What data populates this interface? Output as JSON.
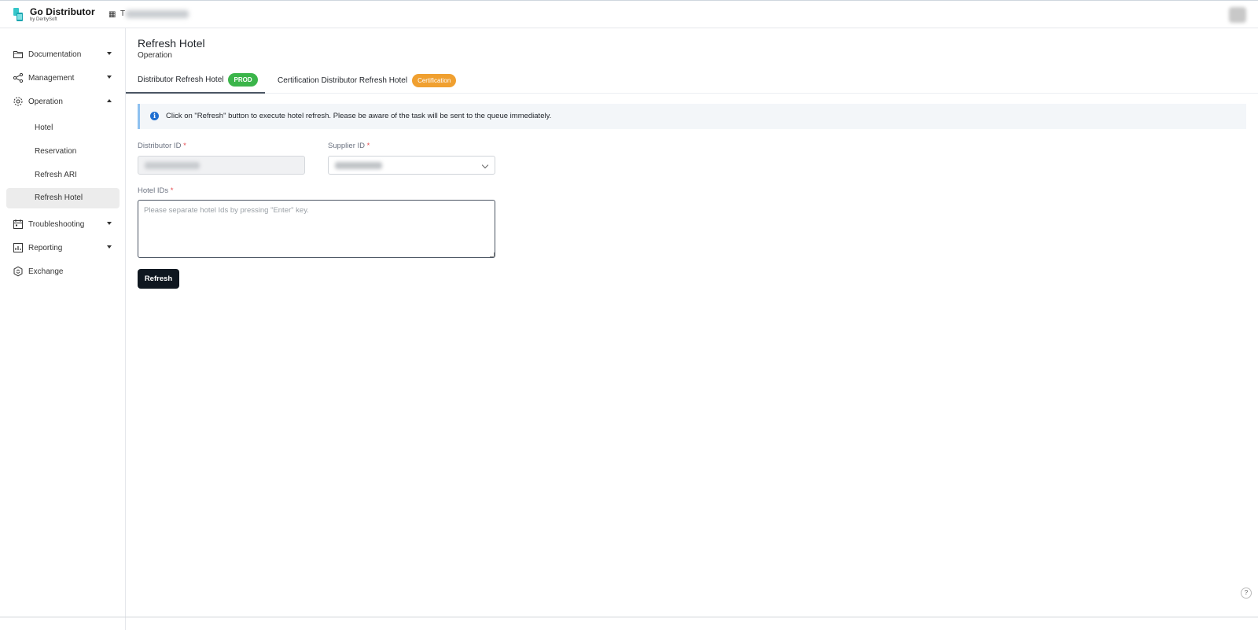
{
  "header": {
    "brand_title": "Go Distributor",
    "brand_subtitle": "by DerbySoft",
    "account_initial": "T"
  },
  "sidebar": {
    "items": [
      {
        "label": "Documentation",
        "icon": "folder-icon",
        "expanded": false
      },
      {
        "label": "Management",
        "icon": "share-icon",
        "expanded": false
      },
      {
        "label": "Operation",
        "icon": "gear-icon",
        "expanded": true
      },
      {
        "label": "Troubleshooting",
        "icon": "calendar-icon",
        "expanded": false
      },
      {
        "label": "Reporting",
        "icon": "report-icon",
        "expanded": false
      },
      {
        "label": "Exchange",
        "icon": "hexagon-icon"
      }
    ],
    "operation_children": [
      {
        "label": "Hotel",
        "active": false
      },
      {
        "label": "Reservation",
        "active": false
      },
      {
        "label": "Refresh ARI",
        "active": false
      },
      {
        "label": "Refresh Hotel",
        "active": true
      }
    ]
  },
  "page": {
    "title": "Refresh Hotel",
    "subtitle": "Operation"
  },
  "tabs": [
    {
      "label": "Distributor Refresh Hotel",
      "badge": "PROD",
      "active": true
    },
    {
      "label": "Certification Distributor Refresh Hotel",
      "badge": "Certification",
      "active": false
    }
  ],
  "alert": {
    "text": "Click on \"Refresh\" button to execute hotel refresh. Please be aware of the task will be sent to the queue immediately."
  },
  "form": {
    "distributor_id_label": "Distributor ID",
    "supplier_id_label": "Supplier ID",
    "hotel_ids_label": "Hotel IDs",
    "required_mark": "*",
    "hotel_ids_placeholder": "Please separate hotel Ids by pressing \"Enter\" key.",
    "refresh_button": "Refresh"
  },
  "colors": {
    "prod_badge": "#3bb54a",
    "cert_badge": "#f0a030",
    "primary_button": "#0f1720",
    "info_icon": "#1f6fd1"
  }
}
